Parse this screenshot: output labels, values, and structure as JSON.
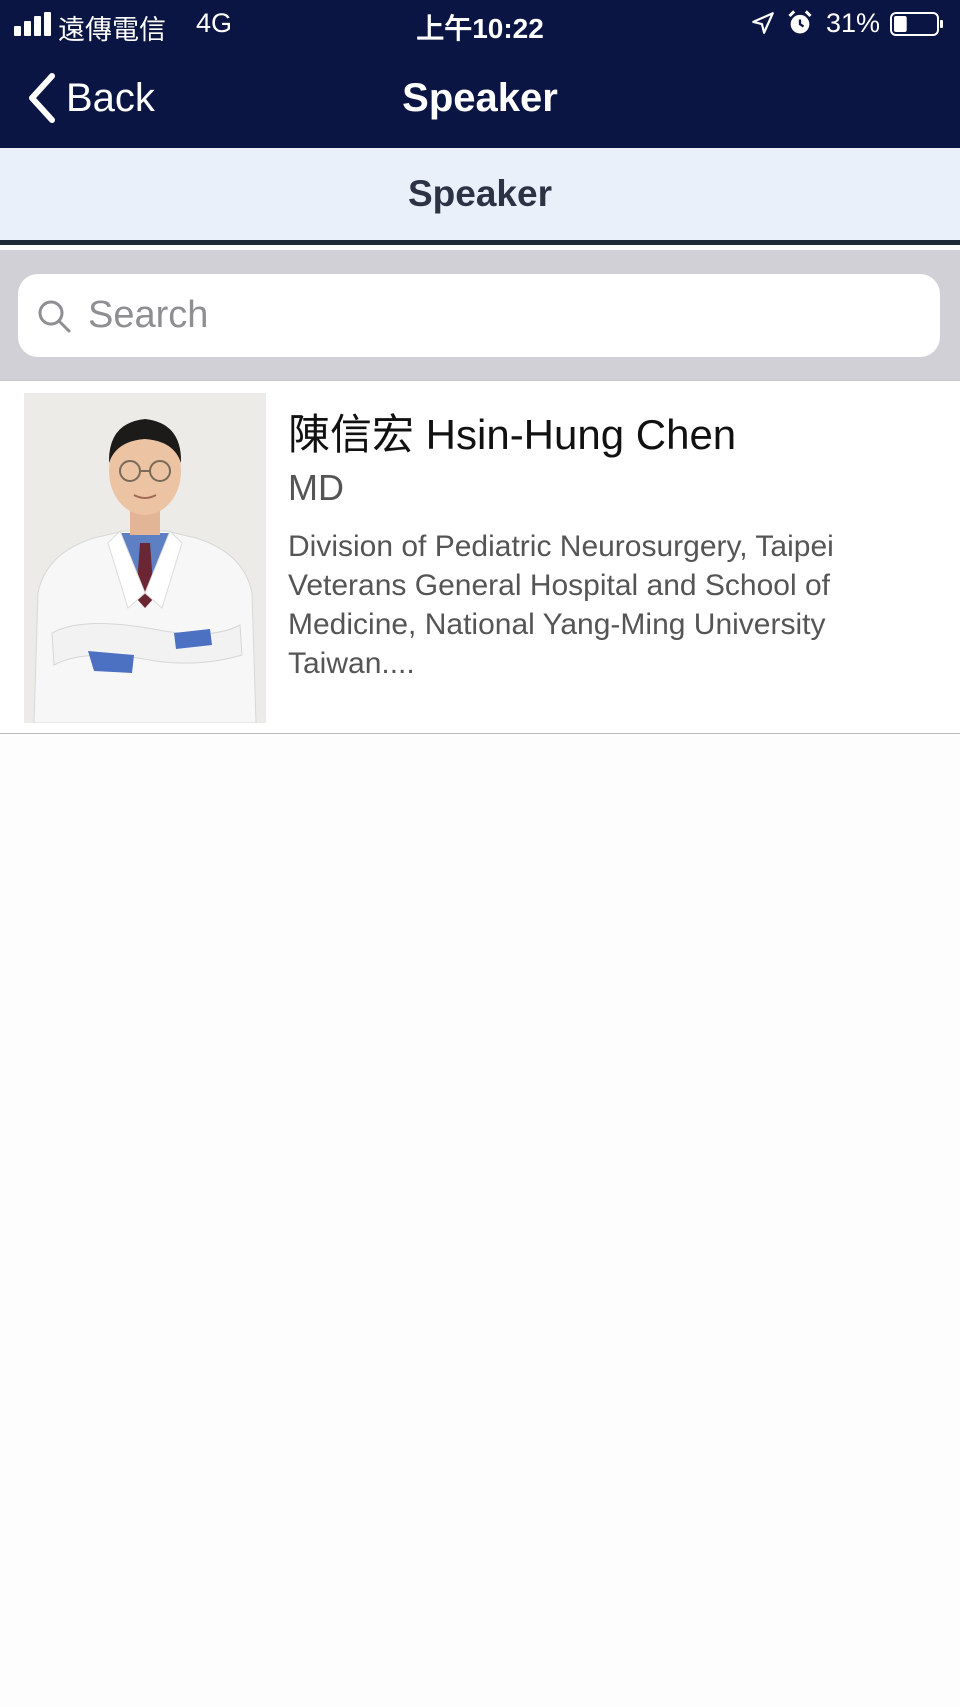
{
  "status_bar": {
    "carrier": "遠傳電信",
    "network": "4G",
    "time": "上午10:22",
    "battery_percent": "31%",
    "battery_level": 0.31,
    "icons": [
      "signal-icon",
      "location-icon",
      "alarm-icon",
      "battery-icon"
    ]
  },
  "nav": {
    "back_label": "Back",
    "title": "Speaker"
  },
  "subheader": {
    "title": "Speaker"
  },
  "search": {
    "placeholder": "Search",
    "value": ""
  },
  "speakers": [
    {
      "name": "陳信宏 Hsin-Hung Chen",
      "title": "MD",
      "affiliation": "Division of Pediatric Neurosurgery, Taipei Veterans General Hospital and School of Medicine, National Yang-Ming University Taiwan...."
    }
  ],
  "colors": {
    "nav_bg": "#0b1543",
    "subheader_bg": "#e9f0fa",
    "search_area_bg": "#d0d0d6"
  }
}
